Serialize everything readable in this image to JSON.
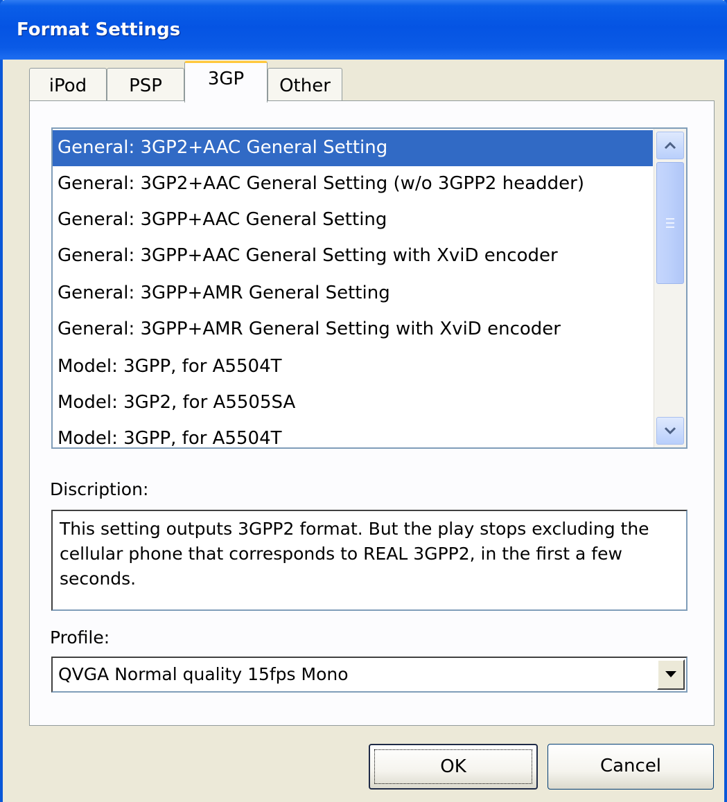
{
  "window": {
    "title": "Format Settings"
  },
  "tabs": [
    {
      "label": "iPod",
      "active": false
    },
    {
      "label": "PSP",
      "active": false
    },
    {
      "label": "3GP",
      "active": true
    },
    {
      "label": "Other",
      "active": false
    }
  ],
  "list": {
    "selected_index": 0,
    "items": [
      "General: 3GP2+AAC General Setting",
      "General: 3GP2+AAC General Setting (w/o 3GPP2 headder)",
      "General: 3GPP+AAC General Setting",
      "General: 3GPP+AAC General Setting with XviD encoder",
      "General: 3GPP+AMR General Setting",
      "General: 3GPP+AMR General Setting with XviD encoder",
      "Model: 3GPP, for A5504T",
      "Model: 3GP2, for A5505SA",
      "Model: 3GPP, for A5504T"
    ]
  },
  "description": {
    "label": "Discription:",
    "text": "This setting outputs 3GPP2 format. But the play stops excluding the cellular phone that corresponds to REAL 3GPP2, in the first a few seconds."
  },
  "profile": {
    "label": "Profile:",
    "value": "QVGA Normal quality 15fps Mono"
  },
  "buttons": {
    "ok": "OK",
    "cancel": "Cancel"
  },
  "colors": {
    "titlebar": "#0554e3",
    "selection": "#316ac5",
    "dialog_bg": "#ece9d8",
    "active_tab_highlight": "#ffc83c"
  },
  "icons": {
    "scroll_up": "chevron-up-icon",
    "scroll_down": "chevron-down-icon",
    "combo_dropdown": "triangle-down-icon"
  }
}
